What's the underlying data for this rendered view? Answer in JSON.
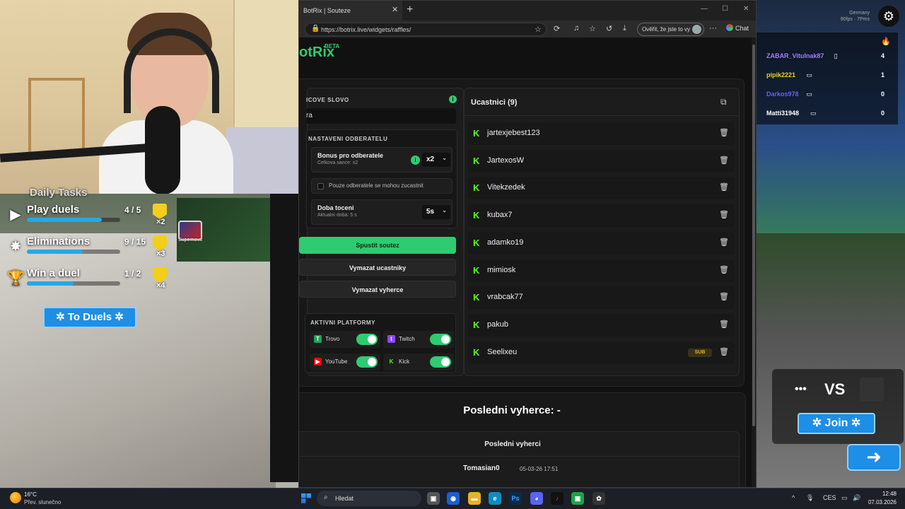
{
  "browser": {
    "tab_title": "BotRix | Souteze",
    "url": "https://botrix.live/widgets/raffles/",
    "verify_label": "Ověřit, že jste to vy",
    "chat_label": "Chat"
  },
  "botrix": {
    "logo": "otRix",
    "logo_badge": "BETA",
    "keyword_label": "ICOVE SLOVO",
    "keyword_value": "ra",
    "subscriber_section_title": "NASTAVENI ODBERATELU",
    "bonus_title": "Bonus pro odberatele",
    "bonus_subtitle": "Celkova sance: x2",
    "bonus_value": "x2",
    "subs_only_label": "Pouze odberatele se mohou zucastnit",
    "spin_title": "Doba toceni",
    "spin_subtitle": "Aktualni doba: 5 s",
    "spin_value": "5s",
    "start_button": "Spustit soutez",
    "clear_participants_button": "Vymazat ucastniky",
    "clear_winners_button": "Vymazat vyherce",
    "platforms_title": "AKTIVNI PLATFORMY",
    "platforms": [
      {
        "name": "Trovo",
        "enabled": true,
        "color": "#1fa35a"
      },
      {
        "name": "Twitch",
        "enabled": true,
        "color": "#9146ff"
      },
      {
        "name": "YouTube",
        "enabled": true,
        "color": "#ff0000"
      },
      {
        "name": "Kick",
        "enabled": true,
        "color": "#53fc18"
      }
    ],
    "participants_title": "Ucastnici (9)",
    "participants": [
      {
        "name": "jartexjebest123",
        "badge": ""
      },
      {
        "name": "JartexosW",
        "badge": ""
      },
      {
        "name": "Vitekzedek",
        "badge": ""
      },
      {
        "name": "kubax7",
        "badge": ""
      },
      {
        "name": "adamko19",
        "badge": ""
      },
      {
        "name": "mimiosk",
        "badge": ""
      },
      {
        "name": "vrabcak77",
        "badge": ""
      },
      {
        "name": "pakub",
        "badge": ""
      },
      {
        "name": "Seelixeu",
        "badge": "SUB"
      }
    ],
    "last_winner_heading": "Posledni vyherce: -",
    "last_winners_title": "Posledni vyherci",
    "last_winners": [
      {
        "name": "Tomasian0",
        "date": "05-03-26 17:51"
      }
    ]
  },
  "game": {
    "tasks_title": "Daily Tasks",
    "tasks": [
      {
        "name": "Play duels",
        "count": "4 / 5",
        "progress": 0.8,
        "mult": "×2",
        "icon": "play-icon"
      },
      {
        "name": "Eliminations",
        "count": "9 / 15",
        "progress": 0.6,
        "mult": "×3",
        "icon": "eliminations-icon"
      },
      {
        "name": "Win a duel",
        "count": "1 / 2",
        "progress": 0.5,
        "mult": "×4",
        "icon": "trophy-icon"
      }
    ],
    "badge_label": "Supernova",
    "to_duels_button": "To Duels",
    "server_region": "Germany",
    "server_stats": "90fps · 7Pms",
    "leaderboard": [
      {
        "name": "ZABAR_Vitulnak87",
        "score": "4",
        "color": "#a77bff",
        "device": "mobile"
      },
      {
        "name": "pipik2221",
        "score": "1",
        "color": "#f2cf1a",
        "device": "pc"
      },
      {
        "name": "Darkos978",
        "score": "0",
        "color": "#6c5cff",
        "device": "pc"
      },
      {
        "name": "Matti31948",
        "score": "0",
        "color": "#ffffff",
        "device": "pc"
      }
    ],
    "vs_label": "VS",
    "join_button": "Join"
  },
  "taskbar": {
    "temperature": "16°C",
    "weather": "Přev. slunečno",
    "search_placeholder": "Hledat",
    "language": "CES",
    "time": "12:48",
    "date": "07.03.2026"
  }
}
